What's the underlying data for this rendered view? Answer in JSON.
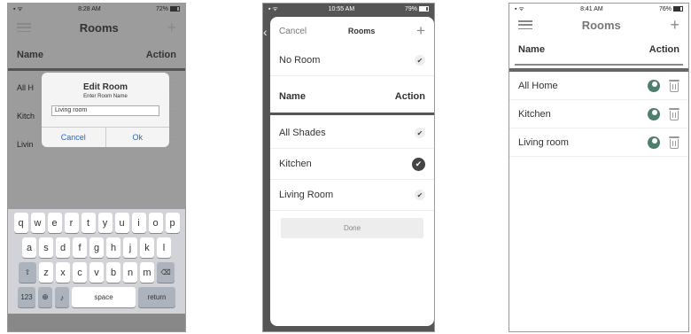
{
  "screen1": {
    "status": {
      "time": "8:28 AM",
      "battery": "72%"
    },
    "title": "Rooms",
    "header": {
      "name": "Name",
      "action": "Action"
    },
    "rows": [
      "All H",
      "Kitch",
      "Livin"
    ],
    "dialog": {
      "title": "Edit Room",
      "subtitle": "Enter Room Name",
      "value": "Living room",
      "cancel": "Cancel",
      "ok": "Ok"
    },
    "keyboard": {
      "row1": [
        "q",
        "w",
        "e",
        "r",
        "t",
        "y",
        "u",
        "i",
        "o",
        "p"
      ],
      "row2": [
        "a",
        "s",
        "d",
        "f",
        "g",
        "h",
        "j",
        "k",
        "l"
      ],
      "row3": [
        "z",
        "x",
        "c",
        "v",
        "b",
        "n",
        "m"
      ],
      "numbers": "123",
      "space": "space",
      "return": "return"
    }
  },
  "screen2": {
    "status": {
      "time": "10:55 AM",
      "battery": "79%"
    },
    "cancel": "Cancel",
    "title": "Rooms",
    "no_room": "No Room",
    "header": {
      "name": "Name",
      "action": "Action"
    },
    "items": [
      {
        "label": "All Shades",
        "selected": false
      },
      {
        "label": "Kitchen",
        "selected": true
      },
      {
        "label": "Living Room",
        "selected": false
      }
    ],
    "done": "Done"
  },
  "screen3": {
    "status": {
      "time": "8:41 AM",
      "battery": "76%"
    },
    "title": "Rooms",
    "header": {
      "name": "Name",
      "action": "Action"
    },
    "rows": [
      "All Home",
      "Kitchen",
      "Living room"
    ]
  },
  "colors": {
    "accent": "#1a6bd1",
    "gear": "#4e7f6a"
  },
  "icons": {
    "check": "✔",
    "plus": "+",
    "back": "‹",
    "shift": "⇧",
    "delete": "⌫",
    "globe": "🌐",
    "mic": "🎙"
  }
}
